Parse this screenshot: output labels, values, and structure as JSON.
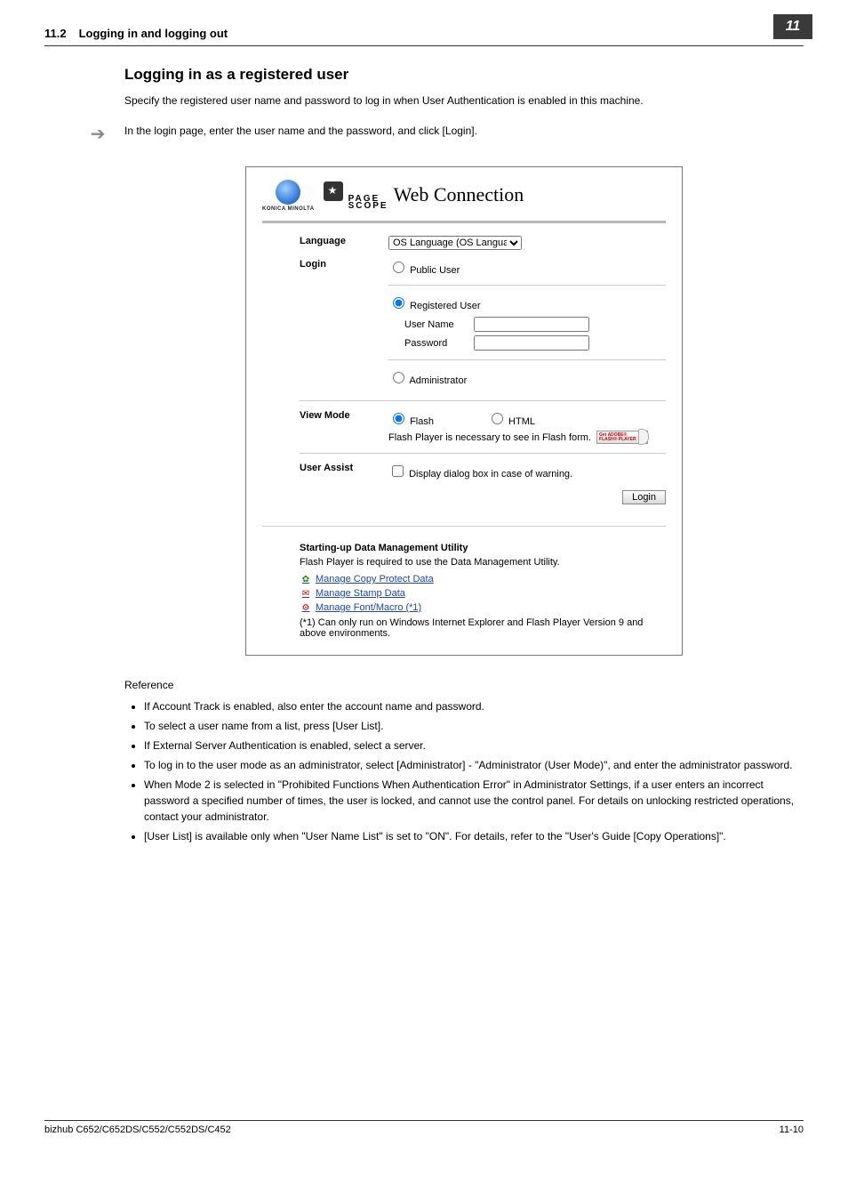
{
  "header": {
    "section_number": "11.2",
    "section_title": "Logging in and logging out",
    "chapter": "11"
  },
  "main": {
    "heading": "Logging in as a registered user",
    "intro": "Specify the registered user name and password to log in when User Authentication is enabled in this machine.",
    "arrow_text": "In the login page, enter the user name and the password, and click [Login]."
  },
  "figure": {
    "brand_small": "KONICA MINOLTA",
    "pagescope_page": "PAGE",
    "pagescope_scope": "SCOPE",
    "web_connection": "Web Connection",
    "labels": {
      "language": "Language",
      "login": "Login",
      "view_mode": "View Mode",
      "user_assist": "User Assist"
    },
    "language_select": "OS Language (OS Language)",
    "login_options": {
      "public_user": "Public User",
      "registered_user": "Registered User",
      "user_name": "User Name",
      "password": "Password",
      "administrator": "Administrator"
    },
    "view_mode": {
      "flash": "Flash",
      "html": "HTML",
      "flash_note": "Flash Player is necessary to see in Flash form.",
      "adobe_top": "Get ADOBE®",
      "adobe_bottom": "FLASH® PLAYER"
    },
    "user_assist_check": "Display dialog box in case of warning.",
    "login_button": "Login",
    "utility": {
      "title": "Starting-up Data Management Utility",
      "note": "Flash Player is required to use the Data Management Utility.",
      "links": {
        "copy_protect": "Manage Copy Protect Data",
        "stamp": "Manage Stamp Data",
        "font_macro": "Manage Font/Macro (*1)"
      },
      "footnote": "(*1) Can only run on Windows Internet Explorer and Flash Player Version 9 and above environments."
    }
  },
  "reference": {
    "heading": "Reference",
    "items": [
      "If Account Track is enabled, also enter the account name and password.",
      "To select a user name from a list, press [User List].",
      "If External Server Authentication is enabled, select a server.",
      "To log in to the user mode as an administrator, select [Administrator] - \"Administrator (User Mode)\", and enter the administrator password.",
      "When Mode 2 is selected in \"Prohibited Functions When Authentication Error\" in Administrator Settings, if a user enters an incorrect password a specified number of times, the user is locked, and cannot use the control panel. For details on unlocking restricted operations, contact your administrator.",
      "[User List] is available only when \"User Name List\" is set to \"ON\". For details, refer to the \"User's Guide [Copy Operations]\"."
    ]
  },
  "footer": {
    "left": "bizhub C652/C652DS/C552/C552DS/C452",
    "right": "11-10"
  }
}
